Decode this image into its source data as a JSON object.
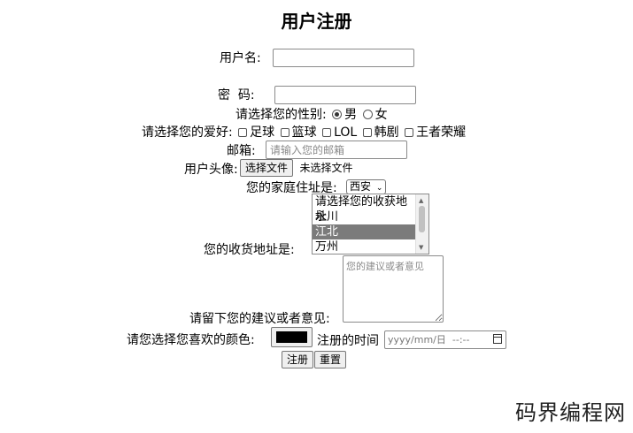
{
  "title": "用户注册",
  "username": {
    "label": "用户名:",
    "value": ""
  },
  "password": {
    "label": "密  码:",
    "value": ""
  },
  "gender": {
    "label": "请选择您的性别:",
    "options": [
      "男",
      "女"
    ],
    "selected": "男"
  },
  "hobbies": {
    "label": "请选择您的爱好:",
    "options": [
      "足球",
      "篮球",
      "LOL",
      "韩剧",
      "王者荣耀"
    ]
  },
  "email": {
    "label": "邮箱:",
    "placeholder": "请输入您的邮箱"
  },
  "avatar": {
    "label": "用户头像:",
    "button": "选择文件",
    "status": "未选择文件"
  },
  "home_address": {
    "label": "您的家庭住址是:",
    "selected": "西安"
  },
  "shipping_address": {
    "label": "您的收货地址是:",
    "options": [
      "请选择您的收获地址",
      "永川",
      "江北",
      "万州"
    ],
    "selected": "江北"
  },
  "suggestion": {
    "label": "请留下您的建议或者意见:",
    "placeholder": "您的建议或者意见"
  },
  "color": {
    "label": "请您选择您喜欢的颜色:",
    "value": "#000000"
  },
  "register_time": {
    "label": "注册的时间",
    "placeholder": "yyyy/mm/日  --:--"
  },
  "buttons": {
    "submit": "注册",
    "reset": "重置"
  },
  "watermark": "码界编程网"
}
